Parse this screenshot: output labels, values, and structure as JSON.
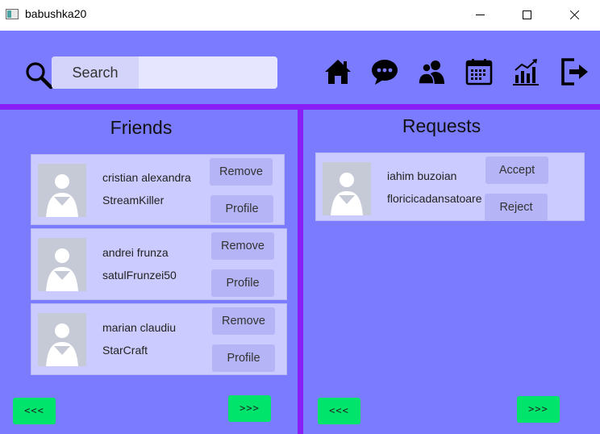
{
  "window": {
    "title": "babushka20"
  },
  "search": {
    "label": "Search",
    "value": ""
  },
  "nav_icons": [
    "home-icon",
    "chat-icon",
    "friends-icon",
    "calendar-icon",
    "stats-icon",
    "logout-icon"
  ],
  "colors": {
    "background": "#7b7bff",
    "divider": "#8a1ff5",
    "card": "#cbcbff",
    "button": "#b4b4f7",
    "pager": "#00e46c"
  },
  "friends": {
    "title": "Friends",
    "items": [
      {
        "name": "cristian alexandra",
        "username": "StreamKiller",
        "remove_label": "Remove",
        "profile_label": "Profile"
      },
      {
        "name": "andrei frunza",
        "username": "satulFrunzei50",
        "remove_label": "Remove",
        "profile_label": "Profile"
      },
      {
        "name": "marian claudiu",
        "username": "StarCraft",
        "remove_label": "Remove",
        "profile_label": "Profile"
      }
    ],
    "prev_label": "<<<",
    "next_label": ">>>"
  },
  "requests": {
    "title": "Requests",
    "items": [
      {
        "name": "iahim buzoian",
        "username": "floricicadansatoare",
        "accept_label": "Accept",
        "reject_label": "Reject"
      }
    ],
    "prev_label": "<<<",
    "next_label": ">>>"
  }
}
